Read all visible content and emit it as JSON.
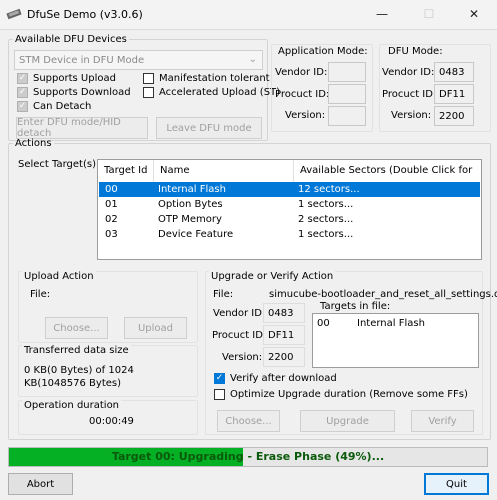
{
  "window": {
    "title": "DfuSe Demo (v3.0.6)",
    "minimize": "—",
    "maximize": "☐",
    "close": "✕"
  },
  "devices": {
    "legend": "Available DFU Devices",
    "selected": "STM Device in DFU Mode",
    "supports_upload": "Supports Upload",
    "supports_download": "Supports Download",
    "can_detach": "Can Detach",
    "manifestation_tolerant": "Manifestation tolerant",
    "accelerated_upload": "Accelerated Upload (ST)",
    "enter_dfu_button": "Enter DFU mode/HID detach",
    "leave_dfu_button": "Leave DFU mode"
  },
  "app_mode": {
    "legend": "Application Mode:",
    "vendor_label": "Vendor ID:",
    "vendor_value": "",
    "product_label": "Procuct ID:",
    "product_value": "",
    "version_label": "Version:",
    "version_value": ""
  },
  "dfu_mode": {
    "legend": "DFU Mode:",
    "vendor_label": "Vendor ID:",
    "vendor_value": "0483",
    "product_label": "Procuct ID:",
    "product_value": "DF11",
    "version_label": "Version:",
    "version_value": "2200"
  },
  "actions": {
    "legend": "Actions",
    "select_targets_label": "Select Target(s):",
    "columns": [
      "Target Id",
      "Name",
      "Available Sectors (Double Click for more)"
    ],
    "rows": [
      {
        "id": "00",
        "name": "Internal Flash",
        "sectors": "12 sectors..."
      },
      {
        "id": "01",
        "name": "Option Bytes",
        "sectors": "1 sectors..."
      },
      {
        "id": "02",
        "name": "OTP Memory",
        "sectors": "2 sectors..."
      },
      {
        "id": "03",
        "name": "Device Feature",
        "sectors": "1 sectors..."
      }
    ]
  },
  "upload": {
    "legend": "Upload Action",
    "file_label": "File:",
    "choose_button": "Choose...",
    "upload_button": "Upload"
  },
  "transferred": {
    "legend": "Transferred data size",
    "text": "0 KB(0 Bytes) of 1024 KB(1048576 Bytes)"
  },
  "duration": {
    "legend": "Operation duration",
    "value": "00:00:49"
  },
  "upgrade": {
    "legend": "Upgrade or Verify Action",
    "file_label": "File:",
    "file_name": "simucube-bootloader_and_reset_all_settings.dfu",
    "vendor_label": "Vendor ID:",
    "vendor_value": "0483",
    "product_label": "Procuct ID:",
    "product_value": "DF11",
    "version_label": "Version:",
    "version_value": "2200",
    "targets_in_file_label": "Targets in file:",
    "targets": [
      {
        "id": "00",
        "name": "Internal Flash"
      }
    ],
    "verify_label": "Verify after download",
    "optimize_label": "Optimize Upgrade duration (Remove some FFs)",
    "choose_button": "Choose...",
    "upgrade_button": "Upgrade",
    "verify_button": "Verify"
  },
  "progress": {
    "text": "Target 00: Upgrading - Erase Phase (49%)...",
    "fraction": 0.49
  },
  "footer": {
    "abort_button": "Abort",
    "quit_button": "Quit"
  },
  "colors": {
    "accent": "#0078d7",
    "progress": "#06b025",
    "selection": "#0078d7"
  }
}
